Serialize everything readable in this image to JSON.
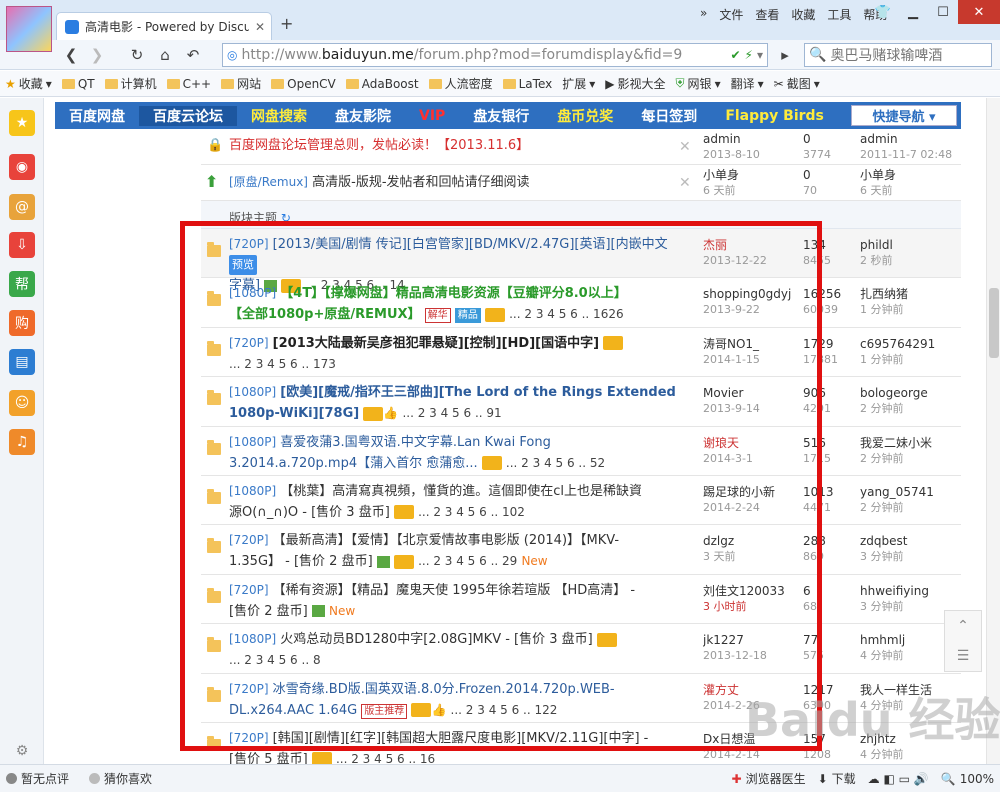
{
  "browser": {
    "tab_title": "高清电影 - Powered by Discuz!",
    "tab_close": "✕",
    "new_tab": "+",
    "menu": [
      "文件",
      "查看",
      "收藏",
      "工具",
      "帮助"
    ],
    "url_prefix": "http://www.",
    "url_domain": "baiduyun.me",
    "url_rest": "/forum.php?mod=forumdisplay&fid=9",
    "search_text": "奥巴马赌球输啤酒",
    "bookmarks": [
      "收藏",
      "QT",
      "计算机",
      "C++",
      "网站",
      "OpenCV",
      "AdaBoost",
      "人流密度",
      "LaTex",
      "扩展",
      "影视大全",
      "网银",
      "翻译",
      "截图"
    ]
  },
  "forum_nav": {
    "items": [
      "百度网盘",
      "百度云论坛",
      "网盘搜索",
      "盘友影院",
      "VIP",
      "盘友银行",
      "盘币兑奖",
      "每日签到",
      "Flappy Birds"
    ],
    "quick_nav": "快捷导航 ▾"
  },
  "section_header": "版块主题",
  "pinned": [
    {
      "title": "百度网盘论坛管理总则，发帖必读！【2013.11.6】",
      "author": "admin",
      "author_date": "2013-8-10",
      "replies": "0",
      "views": "3774",
      "last_user": "admin",
      "last_time": "2011-11-7 02:48"
    },
    {
      "tag": "[原盘/Remux]",
      "title": "高清版-版规-发帖者和回帖请仔细阅读",
      "author": "小单身",
      "author_date": "6 天前",
      "replies": "0",
      "views": "70",
      "last_user": "小单身",
      "last_time": "6 天前"
    }
  ],
  "threads": [
    {
      "tag": "[720P]",
      "title": "[2013/美国/剧情 传记][白宫管家][BD/MKV/2.47G][英语][内嵌中文",
      "title2": "字幕]",
      "preview": "预览",
      "pages": "... 2 3 4 5 6 .. 14",
      "author": "杰丽",
      "author_date": "2013-12-22",
      "replies": "134",
      "views": "8455",
      "last_user": "phildl",
      "last_time": "2 秒前"
    },
    {
      "tag": "[1080P]",
      "title": "【4T】【撑爆网盘】精品高清电影资源【豆瓣评分8.0以上】",
      "title2": "【全部1080p+原盘/REMUX】",
      "badge1": "解华",
      "badge2": "精品",
      "pages": "... 2 3 4 5 6 .. 1626",
      "author": "shopping0gdyj",
      "author_date": "2013-9-22",
      "replies": "16256",
      "views": "60039",
      "last_user": "扎西纳猪",
      "last_time": "1 分钟前"
    },
    {
      "tag": "[720P]",
      "title": "[2013大陆最新吴彦祖犯罪悬疑][控制][HD][国语中字]",
      "pages": "... 2 3 4 5 6 .. 173",
      "author": "涛哥NO1_",
      "author_date": "2014-1-15",
      "replies": "1729",
      "views": "17881",
      "last_user": "c695764291",
      "last_time": "1 分钟前"
    },
    {
      "tag": "[1080P]",
      "title": "[欧美][魔戒/指环王三部曲][The Lord of the Rings Extended",
      "title2": "1080p-WiKi][78G]",
      "pages": "... 2 3 4 5 6 .. 91",
      "author": "Movier",
      "author_date": "2013-9-14",
      "replies": "906",
      "views": "4291",
      "last_user": "bologeorge",
      "last_time": "2 分钟前"
    },
    {
      "tag": "[1080P]",
      "title": "喜爱夜蒲3.国粤双语.中文字幕.Lan Kwai Fong",
      "title2": "3.2014.a.720p.mp4【蒲入首尔 愈蒲愈...",
      "pages": "... 2 3 4 5 6 .. 52",
      "author": "谢琅天",
      "author_date": "2014-3-1",
      "replies": "516",
      "views": "1715",
      "last_user": "我爱二妹小米",
      "last_time": "2 分钟前"
    },
    {
      "tag": "[1080P]",
      "title": "【桃葉】高清寫真視頻，懂貨的進。這個即使在cl上也是稀缺資",
      "title2": "源O(∩_∩)O - [售价 3 盘币]",
      "pages": "... 2 3 4 5 6 .. 102",
      "author": "踢足球的小新",
      "author_date": "2014-2-24",
      "replies": "1013",
      "views": "4471",
      "last_user": "yang_05741",
      "last_time": "2 分钟前"
    },
    {
      "tag": "[720P]",
      "title": "【最新高清】【爱情】【北京爱情故事电影版 (2014)】【MKV-",
      "title2": "1.35G】 - [售价 2 盘币]",
      "pages": "... 2 3 4 5 6 .. 29",
      "new": "New",
      "author": "dzlgz",
      "author_date": "3 天前",
      "replies": "288",
      "views": "869",
      "last_user": "zdqbest",
      "last_time": "3 分钟前"
    },
    {
      "tag": "[720P]",
      "title": "【稀有资源】【精品】魔鬼天使 1995年徐若瑄版 【HD高清】 -",
      "title2": "[售价 2 盘币]",
      "new": "New",
      "author": "刘佳文120033",
      "author_date": "3 小时前",
      "replies": "6",
      "views": "68",
      "last_user": "hhweifiying",
      "last_time": "3 分钟前"
    },
    {
      "tag": "[1080P]",
      "title": "火鸡总动员BD1280中字[2.08G]MKV - [售价 3 盘币]",
      "pages": "... 2 3 4 5 6 .. 8",
      "author": "jk1227",
      "author_date": "2013-12-18",
      "replies": "77",
      "views": "575",
      "last_user": "hmhmlj",
      "last_time": "4 分钟前"
    },
    {
      "tag": "[720P]",
      "title": "冰雪奇缘.BD版.国英双语.8.0分.Frozen.2014.720p.WEB-",
      "title2": "DL.x264.AAC 1.64G",
      "badge1": "版主推荐",
      "pages": "... 2 3 4 5 6 .. 122",
      "author": "灌方丈",
      "author_date": "2014-2-26",
      "replies": "1217",
      "views": "6390",
      "last_user": "我人一样生活",
      "last_time": "4 分钟前"
    },
    {
      "tag": "[720P]",
      "title": "[韩国][剧情][红字][韩国超大胆露尺度电影][MKV/2.11G][中字] -",
      "title2": "[售价 5 盘币]",
      "pages": "... 2 3 4 5 6 .. 16",
      "author": "Dx日想温",
      "author_date": "2014-2-14",
      "replies": "157",
      "views": "1208",
      "last_user": "zhjhtz",
      "last_time": "4 分钟前"
    }
  ],
  "status": {
    "left1": "暂无点评",
    "left2": "猜你喜欢",
    "doctor": "浏览器医生",
    "download": "下载",
    "zoom": "100%"
  },
  "watermark": "Baidu 经验"
}
